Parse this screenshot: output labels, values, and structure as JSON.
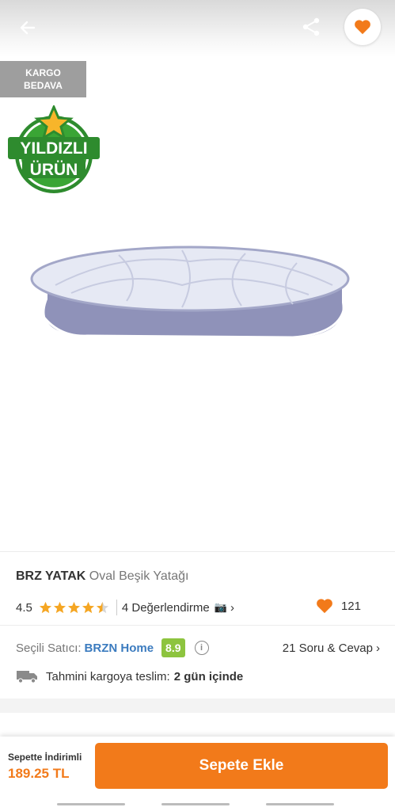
{
  "badges": {
    "cargo_line1": "KARGO",
    "cargo_line2": "BEDAVA",
    "star_line1": "YILDIZLI",
    "star_line2": "ÜRÜN"
  },
  "icons": {
    "back": "back-arrow-icon",
    "share": "share-icon",
    "favorite": "heart-icon"
  },
  "product": {
    "brand": "BRZ YATAK",
    "name": "Oval Beşik Yatağı"
  },
  "rating": {
    "score": "4.5",
    "stars": 4.5,
    "reviews": "4 Değerlendirme",
    "camera": "📷",
    "chevron": "›",
    "likes": "121"
  },
  "seller": {
    "label": "Seçili Satıcı:",
    "name": "BRZN Home",
    "score": "8.9",
    "info": "i",
    "qa": "21 Soru & Cevap",
    "chevron": "›"
  },
  "delivery": {
    "label": "Tahmini kargoya teslim:",
    "value": "2 gün içinde"
  },
  "cart": {
    "discount_label": "Sepette İndirimli",
    "price": "189.25 TL",
    "button": "Sepete Ekle"
  },
  "colors": {
    "accent": "#f27a1a",
    "seller_link": "#3b7bbf",
    "score_green": "#8dc43f",
    "badge_gray": "#9e9e9e"
  }
}
